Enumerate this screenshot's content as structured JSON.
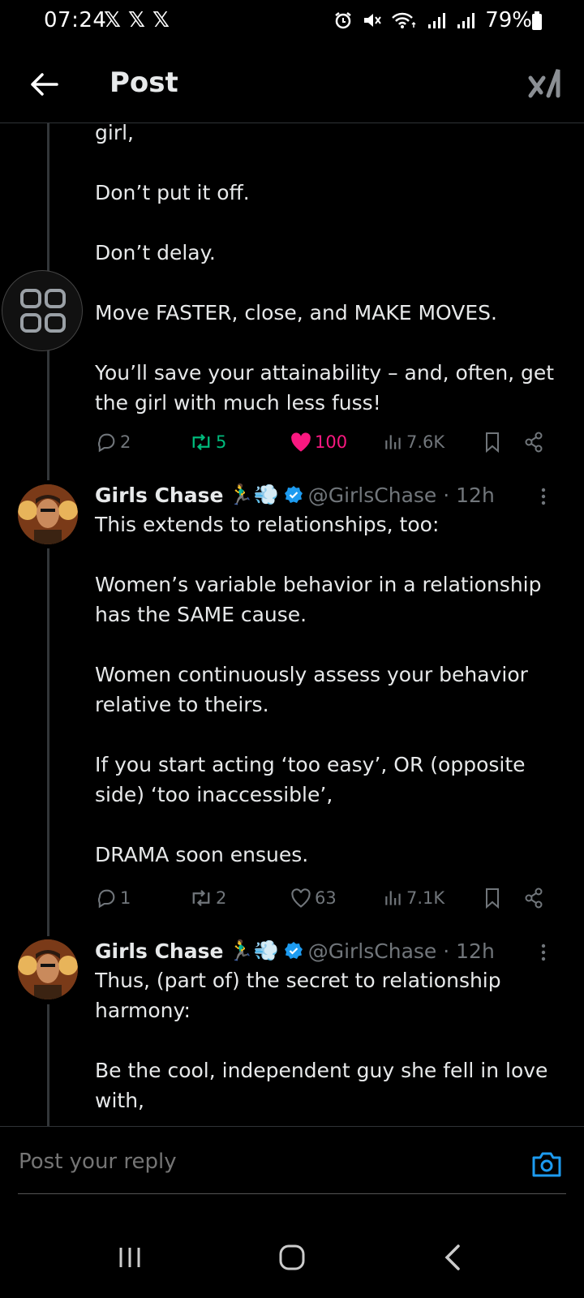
{
  "status_bar": {
    "time": "07:24",
    "x_badges": [
      "𝕏",
      "𝕏",
      "𝕏"
    ],
    "battery": "79%"
  },
  "header": {
    "title": "Post"
  },
  "posts": [
    {
      "text": "girl,\n\nDon’t put it off.\n\nDon’t delay.\n\nMove FASTER, close, and MAKE MOVES.\n\nYou’ll save your attainability – and, often, get the girl with much less fuss!",
      "replies": "2",
      "reposts": "5",
      "likes": "100",
      "views": "7.6K"
    },
    {
      "author": "Girls Chase",
      "emoji": "🏃‍♂️💨",
      "handle": "@GirlsChase · 12h",
      "text": "This extends to relationships, too:\n\nWomen’s variable behavior in a relationship has the SAME cause.\n\nWomen continuously assess your behavior relative to theirs.\n\nIf you start acting ‘too easy’, OR (opposite side) ‘too inaccessible’,\n\nDRAMA soon ensues.",
      "replies": "1",
      "reposts": "2",
      "likes": "63",
      "views": "7.1K"
    },
    {
      "author": "Girls Chase",
      "emoji": "🏃‍♂️💨",
      "handle": "@GirlsChase · 12h",
      "text": "Thus, (part of) the secret to relationship harmony:\n\nBe the cool, independent guy she fell in love with,"
    }
  ],
  "reply_bar": {
    "placeholder": "Post your reply"
  },
  "colors": {
    "background": "#000000",
    "text": "#e7e9ea",
    "muted": "#71767b",
    "like": "#f91880",
    "repost": "#00ba7c",
    "accent": "#1d9bf0"
  }
}
